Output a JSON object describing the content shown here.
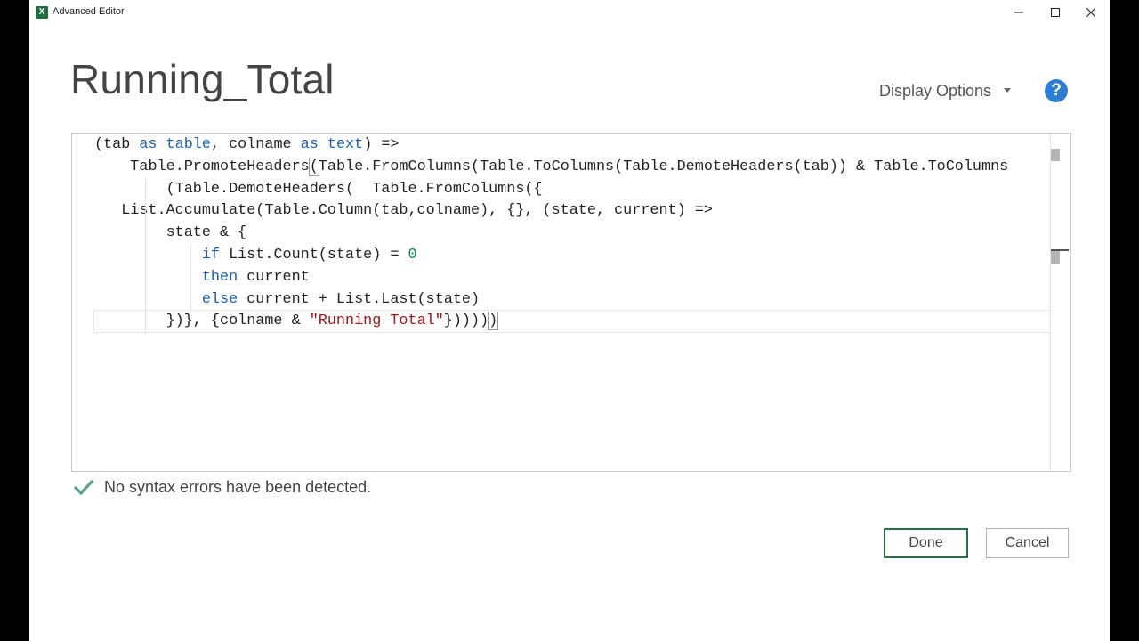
{
  "window": {
    "title": "Advanced Editor",
    "app_icon_text": "X",
    "controls": {
      "minimize": "minimize-icon",
      "maximize": "maximize-icon",
      "close": "close-icon"
    }
  },
  "header": {
    "query_name": "Running_Total",
    "display_options_label": "Display Options",
    "help_label": "?"
  },
  "editor": {
    "lines": [
      {
        "indent": "",
        "tokens": [
          {
            "t": "(tab "
          },
          {
            "t": "as",
            "c": "kw"
          },
          {
            "t": " "
          },
          {
            "t": "table",
            "c": "kw"
          },
          {
            "t": ", colname "
          },
          {
            "t": "as",
            "c": "kw"
          },
          {
            "t": " "
          },
          {
            "t": "text",
            "c": "kw"
          },
          {
            "t": ") =>"
          }
        ]
      },
      {
        "indent": "    ",
        "tokens": [
          {
            "t": "Table.PromoteHeaders"
          },
          {
            "t": "(",
            "c": "hl"
          },
          {
            "t": "Table.FromColumns(Table.ToColumns(Table.DemoteHeaders(tab)) & Table.ToColumns"
          }
        ]
      },
      {
        "indent": "        ",
        "tokens": [
          {
            "t": "(Table.DemoteHeaders(  Table.FromColumns({"
          }
        ]
      },
      {
        "indent": "   ",
        "tokens": [
          {
            "t": "List.Accumulate(Table.Column(tab,colname), {}, (state, current) =>"
          }
        ]
      },
      {
        "indent": "        ",
        "tokens": [
          {
            "t": "state & {"
          }
        ]
      },
      {
        "indent": "            ",
        "tokens": [
          {
            "t": "if",
            "c": "kw"
          },
          {
            "t": " List.Count(state) = "
          },
          {
            "t": "0",
            "c": "num"
          }
        ]
      },
      {
        "indent": "            ",
        "tokens": [
          {
            "t": "then",
            "c": "kw"
          },
          {
            "t": " current"
          }
        ]
      },
      {
        "indent": "            ",
        "tokens": [
          {
            "t": "else",
            "c": "kw"
          },
          {
            "t": " current + List.Last(state)"
          }
        ]
      },
      {
        "indent": "        ",
        "current": true,
        "tokens": [
          {
            "t": "})}, {colname & "
          },
          {
            "t": "\"Running Total\"",
            "c": "str"
          },
          {
            "t": "}))))"
          },
          {
            "t": ")",
            "c": "hl"
          }
        ]
      }
    ]
  },
  "status": {
    "icon": "checkmark-icon",
    "message": "No syntax errors have been detected."
  },
  "buttons": {
    "done": "Done",
    "cancel": "Cancel"
  },
  "colors": {
    "keyword": "#1a5fb4",
    "number": "#098658",
    "string": "#a31515",
    "check": "#5aa38a",
    "help": "#2e7ed6",
    "done_border": "#217346"
  }
}
